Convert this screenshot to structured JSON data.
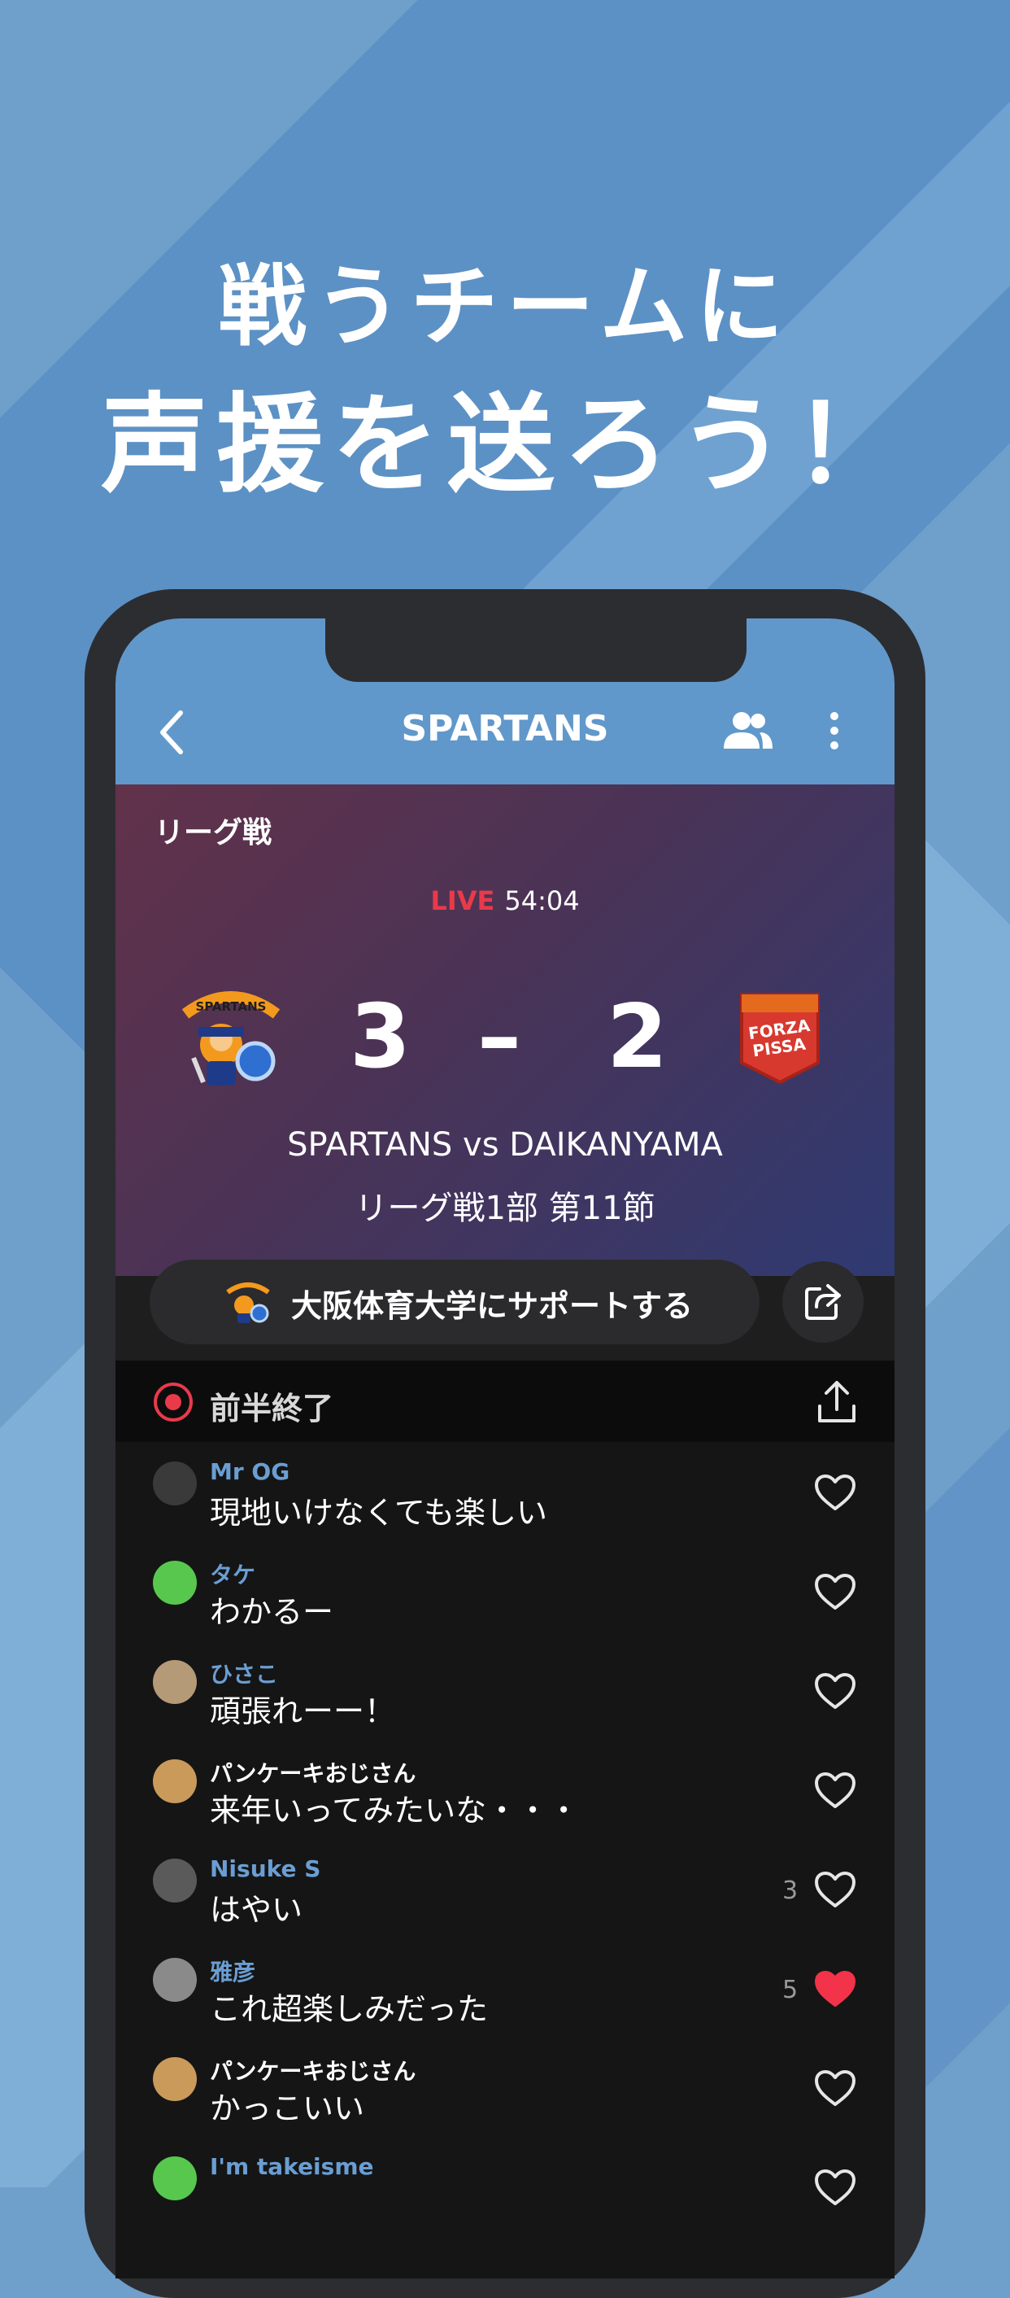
{
  "promo": {
    "line1": "戦うチームに",
    "line2": "声援を送ろう！"
  },
  "appbar": {
    "title": "SPARTANS"
  },
  "match": {
    "league": "リーグ戦",
    "live_label": "LIVE",
    "clock": "54:04",
    "home_score": "3",
    "dash": "–",
    "away_score": "2",
    "matchup": "SPARTANS vs DAIKANYAMA",
    "round": "リーグ戦1部 第11節",
    "home_crest_text": "SPARTANS",
    "away_crest_text": "FORZA PISSA"
  },
  "support": {
    "label": "大阪体育大学にサポートする"
  },
  "status": {
    "label": "前半終了"
  },
  "comments": [
    {
      "name": "Mr OG",
      "text": "現地いけなくても楽しい",
      "likes": "",
      "liked": false,
      "name_color": "blue",
      "avatar": "#3a3a3a"
    },
    {
      "name": "タケ",
      "text": "わかるー",
      "likes": "",
      "liked": false,
      "name_color": "blue",
      "avatar": "#57c84d"
    },
    {
      "name": "ひさこ",
      "text": "頑張れーー！",
      "likes": "",
      "liked": false,
      "name_color": "blue",
      "avatar": "#b59a78"
    },
    {
      "name": "パンケーキおじさん",
      "text": "来年いってみたいな・・・",
      "likes": "",
      "liked": false,
      "name_color": "white",
      "avatar": "#c99a5a"
    },
    {
      "name": "Nisuke S",
      "text": "はやい",
      "likes": "3",
      "liked": false,
      "name_color": "blue",
      "avatar": "#5a5a5a"
    },
    {
      "name": "雅彦",
      "text": "これ超楽しみだった",
      "likes": "5",
      "liked": true,
      "name_color": "blue",
      "avatar": "#8a8a8a"
    },
    {
      "name": "パンケーキおじさん",
      "text": "かっこいい",
      "likes": "",
      "liked": false,
      "name_color": "white",
      "avatar": "#c99a5a"
    },
    {
      "name": "I'm takeisme",
      "text": "",
      "likes": "",
      "liked": false,
      "name_color": "blue",
      "avatar": "#57c84d"
    }
  ],
  "colors": {
    "accent": "#6198cb",
    "live": "#e83a4a",
    "heart_liked": "#f2334a"
  }
}
